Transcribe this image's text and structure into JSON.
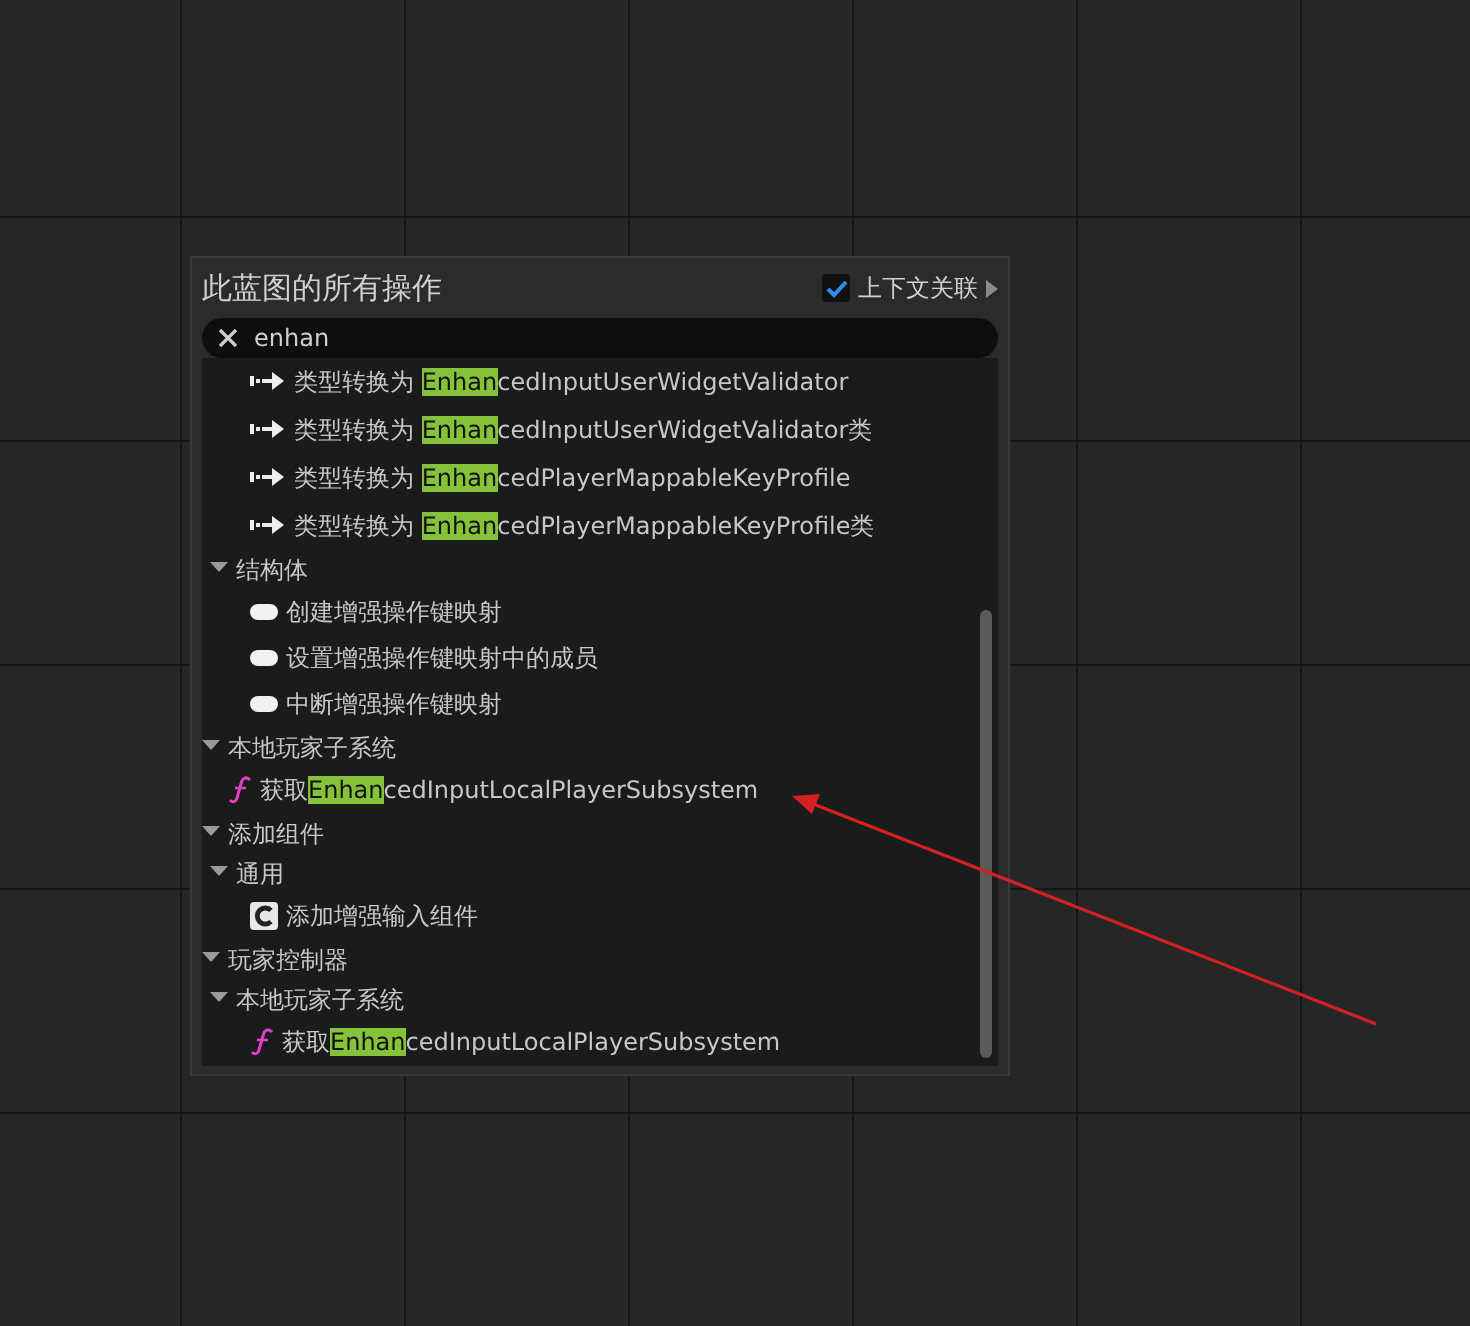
{
  "panel": {
    "title": "此蓝图的所有操作",
    "context_toggle": {
      "label": "上下文关联",
      "checked": true
    },
    "search": {
      "value": "enhan"
    },
    "tree": [
      {
        "kind": "scrolled",
        "children": [
          {
            "kind": "scrolled",
            "children": [
              {
                "kind": "cast",
                "label": "类型转换为 **Enhan**cedInputUserWidgetValidator"
              },
              {
                "kind": "cast",
                "label": "类型转换为 **Enhan**cedInputUserWidgetValidator类"
              },
              {
                "kind": "cast",
                "label": "类型转换为 **Enhan**cedPlayerMappableKeyProfile"
              },
              {
                "kind": "cast",
                "label": "类型转换为 **Enhan**cedPlayerMappableKeyProfile类"
              }
            ]
          },
          {
            "kind": "category",
            "label": "结构体",
            "expanded": true,
            "children": [
              {
                "kind": "struct",
                "label": "创建增强操作键映射"
              },
              {
                "kind": "struct",
                "label": "设置增强操作键映射中的成员"
              },
              {
                "kind": "struct",
                "label": "中断增强操作键映射"
              }
            ]
          }
        ]
      },
      {
        "kind": "category",
        "label": "本地玩家子系统",
        "expanded": true,
        "children": [
          {
            "kind": "function",
            "label": "获取**Enhan**cedInputLocalPlayerSubsystem"
          }
        ]
      },
      {
        "kind": "category",
        "label": "添加组件",
        "expanded": true,
        "children": [
          {
            "kind": "category",
            "label": "通用",
            "expanded": true,
            "children": [
              {
                "kind": "component",
                "label": "添加增强输入组件"
              }
            ]
          }
        ]
      },
      {
        "kind": "category",
        "label": "玩家控制器",
        "expanded": true,
        "children": [
          {
            "kind": "category",
            "label": "本地玩家子系统",
            "expanded": true,
            "children": [
              {
                "kind": "function",
                "label": "获取**Enhan**cedInputLocalPlayerSubsystem"
              }
            ]
          }
        ]
      }
    ]
  }
}
